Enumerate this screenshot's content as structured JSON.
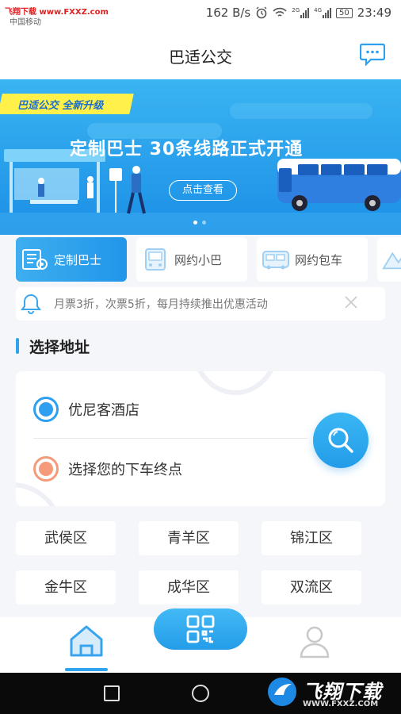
{
  "status_bar": {
    "watermark": "飞翔下载 www.FXXZ.com",
    "carrier": "中国移动",
    "speed": "162 B/s",
    "network_2g": "2G",
    "network_4g": "4G",
    "battery": "50",
    "time": "23:49"
  },
  "header": {
    "title": "巴适公交",
    "message_icon": "chat-bubble-icon"
  },
  "banner": {
    "tag": "巴适公交 全新升级",
    "headline": "定制巴士 30条线路正式开通",
    "cta": "点击查看",
    "slide_count": 2,
    "active_slide": 1
  },
  "services": [
    {
      "label": "定制巴士",
      "icon": "custom-bus-icon",
      "active": true
    },
    {
      "label": "网约小巴",
      "icon": "minibus-icon",
      "active": false
    },
    {
      "label": "网约包车",
      "icon": "charter-bus-icon",
      "active": false
    }
  ],
  "notice": {
    "text": "月票3折，次票5折，每月持续推出优惠活动",
    "icon": "bell-icon"
  },
  "section": {
    "title": "选择地址"
  },
  "address": {
    "from": "优尼客酒店",
    "to": "选择您的下车终点",
    "search_icon": "search-icon"
  },
  "districts": [
    "武侯区",
    "青羊区",
    "锦江区",
    "金牛区",
    "成华区",
    "双流区"
  ],
  "tabbar": {
    "home_icon": "home-icon",
    "scan_icon": "qr-scan-icon",
    "user_icon": "user-icon"
  },
  "nav_watermark": {
    "name": "飞翔下载",
    "url": "WWW.FXXZ.COM"
  },
  "colors": {
    "accent": "#2fa3ee",
    "orange": "#f59a7a",
    "banner_tag": "#fff04a"
  }
}
